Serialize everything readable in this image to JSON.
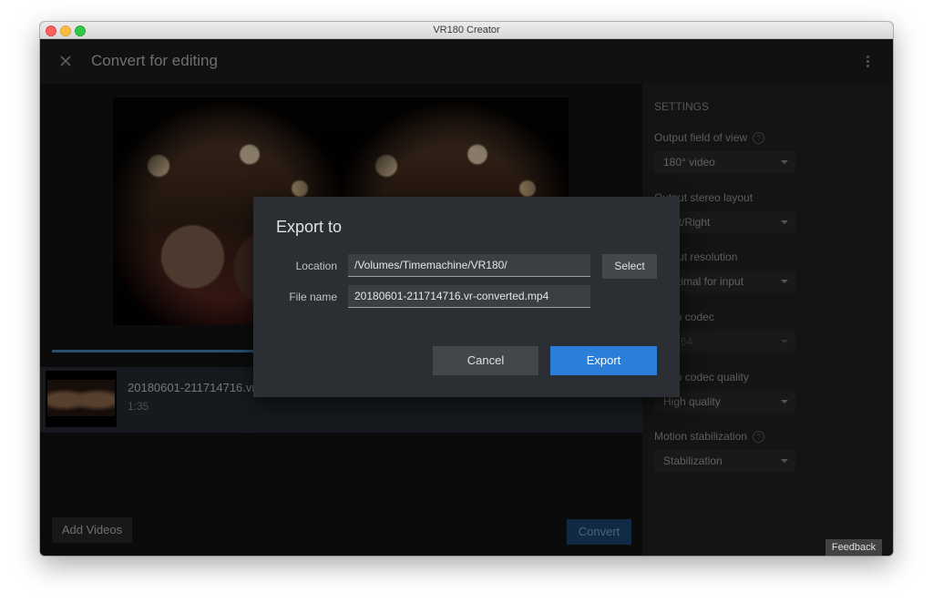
{
  "window": {
    "title": "VR180 Creator"
  },
  "appbar": {
    "title": "Convert for editing"
  },
  "video": {
    "name": "20180601-211714716.vr.m",
    "duration": "1:35"
  },
  "left": {
    "add_videos_label": "Add Videos",
    "convert_label": "Convert"
  },
  "settings": {
    "title": "SETTINGS",
    "items": [
      {
        "label": "Output field of view",
        "value": "180° video",
        "help": true,
        "disabled": false
      },
      {
        "label": "Output stereo layout",
        "value": "Left/Right",
        "help": false,
        "disabled": false
      },
      {
        "label": "Output resolution",
        "value": "Optimal for input",
        "help": false,
        "disabled": false
      },
      {
        "label": "Video codec",
        "value": "H.264",
        "help": false,
        "disabled": true
      },
      {
        "label": "Video codec quality",
        "value": "High quality",
        "help": false,
        "disabled": false
      },
      {
        "label": "Motion stabilization",
        "value": "Stabilization",
        "help": true,
        "disabled": false
      }
    ]
  },
  "dialog": {
    "title": "Export to",
    "location_label": "Location",
    "location_value": "/Volumes/Timemachine/VR180/",
    "filename_label": "File name",
    "filename_value": "20180601-211714716.vr-converted.mp4",
    "select_label": "Select",
    "cancel_label": "Cancel",
    "export_label": "Export"
  },
  "feedback_label": "Feedback",
  "colors": {
    "accent": "#2b7fd8",
    "progress": "#4a90c9",
    "background": "#1f1f1f"
  }
}
